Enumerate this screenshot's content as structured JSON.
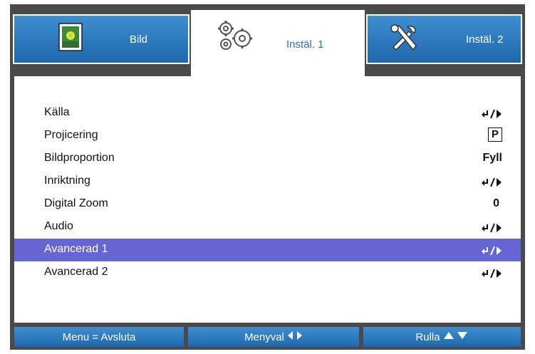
{
  "tabs": [
    {
      "label": "Bild",
      "icon": "picture-icon",
      "active": false
    },
    {
      "label": "Instäl. 1",
      "icon": "gears-icon",
      "active": true
    },
    {
      "label": "Instäl. 2",
      "icon": "tools-icon",
      "active": false
    }
  ],
  "menu": {
    "items": [
      {
        "label": "Källa",
        "value": "",
        "value_icon": "enter-arrow-icon"
      },
      {
        "label": "Projicering",
        "value": "P",
        "value_icon": "boxed-p"
      },
      {
        "label": "Bildproportion",
        "value": "Fyll",
        "value_icon": ""
      },
      {
        "label": "Inriktning",
        "value": "",
        "value_icon": "enter-arrow-icon"
      },
      {
        "label": "Digital Zoom",
        "value": "0",
        "value_icon": ""
      },
      {
        "label": "Audio",
        "value": "",
        "value_icon": "enter-arrow-icon"
      },
      {
        "label": "Avancerad 1",
        "value": "",
        "value_icon": "enter-arrow-icon"
      },
      {
        "label": "Avancerad 2",
        "value": "",
        "value_icon": "enter-arrow-icon"
      }
    ],
    "selected_index": 6
  },
  "footer": {
    "exit_label": "Menu = Avsluta",
    "menu_select_label": "Menyval",
    "scroll_label": "Rulla"
  },
  "colors": {
    "tab_blue": "#2a78c4",
    "selection": "#6565d3",
    "frame": "#4a4a4a"
  }
}
